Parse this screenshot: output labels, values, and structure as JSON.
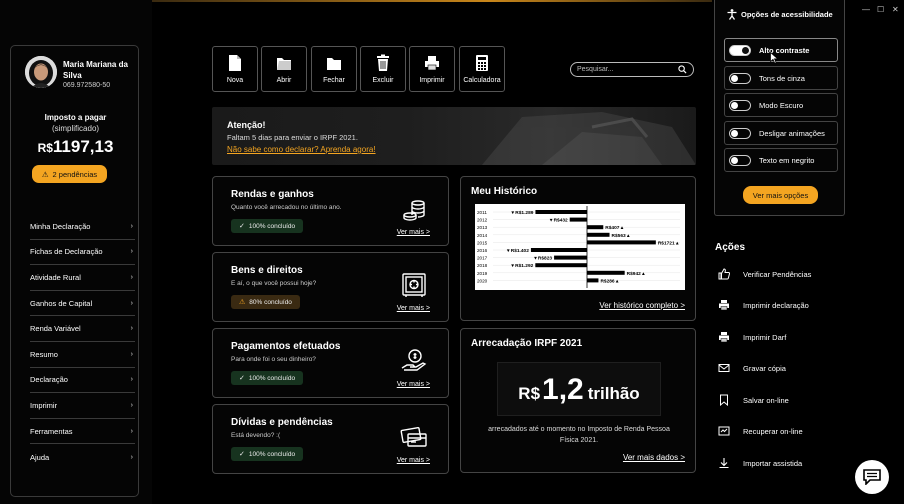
{
  "user": {
    "name": "Maria Mariana da Silva",
    "cpf": "069.972580-50"
  },
  "tax": {
    "label": "Imposto a pagar",
    "sub": "(simplificado)",
    "currency": "R$",
    "amount": "1197,13",
    "pending_label": "2 pendências"
  },
  "menu": [
    {
      "label": "Minha Declaração"
    },
    {
      "label": "Fichas de Declaração"
    },
    {
      "label": "Atividade Rural"
    },
    {
      "label": "Ganhos de Capital"
    },
    {
      "label": "Renda Variável"
    },
    {
      "label": "Resumo"
    },
    {
      "label": "Declaração"
    },
    {
      "label": "Imprimir"
    },
    {
      "label": "Ferramentas"
    },
    {
      "label": "Ajuda"
    }
  ],
  "toolbar": [
    {
      "label": "Nova",
      "icon": "file-icon"
    },
    {
      "label": "Abrir",
      "icon": "open-folder-icon"
    },
    {
      "label": "Fechar",
      "icon": "folder-icon"
    },
    {
      "label": "Excluir",
      "icon": "trash-icon"
    },
    {
      "label": "Imprimir",
      "icon": "printer-icon"
    },
    {
      "label": "Calculadora",
      "icon": "calculator-icon"
    }
  ],
  "search": {
    "placeholder": "Pesquisar..."
  },
  "alert": {
    "title": "Atenção!",
    "text": "Faltam 5 dias para enviar o IRPF 2021.",
    "link": "Não sabe como declarar? Aprenda agora!"
  },
  "cards": [
    {
      "title": "Rendas e ganhos",
      "sub": "Quanto você arrecadou no último ano.",
      "badge": "100% concluído",
      "status": "done",
      "link": "Ver mais >",
      "icon": "coins-icon"
    },
    {
      "title": "Bens e direitos",
      "sub": "E aí, o que você possui hoje?",
      "badge": "80% concluído",
      "status": "warn",
      "link": "Ver mais >",
      "icon": "safe-icon"
    },
    {
      "title": "Pagamentos efetuados",
      "sub": "Para onde foi o seu dinheiro?",
      "badge": "100% concluído",
      "status": "done",
      "link": "Ver mais >",
      "icon": "hand-coin-icon"
    },
    {
      "title": "Dívidas e pendências",
      "sub": "Está devendo? :(",
      "badge": "100% concluído",
      "status": "done",
      "link": "Ver mais >",
      "icon": "credit-cards-icon"
    }
  ],
  "historico": {
    "title": "Meu Histórico",
    "link": "Ver histórico completo >"
  },
  "chart_data": {
    "type": "bar",
    "orientation": "horizontal-diverging",
    "categories": [
      "2011",
      "2012",
      "2013",
      "2014",
      "2015",
      "2016",
      "2017",
      "2018",
      "2019",
      "2020"
    ],
    "values": [
      -1289,
      -432,
      407,
      563,
      1721,
      -1402,
      -823,
      -1292,
      942,
      286
    ],
    "labels": [
      "R$1.289",
      "R$432",
      "R$407",
      "R$563",
      "R$1721",
      "R$1.402",
      "R$823",
      "R$1.292",
      "R$942",
      "R$286"
    ]
  },
  "arrecadacao": {
    "title": "Arrecadação IRPF 2021",
    "currency": "R$",
    "number": "1,2",
    "unit": "trilhão",
    "desc": "arrecadados até o momento no Imposto de Renda Pessoa Física 2021.",
    "link": "Ver mais dados >"
  },
  "accessibility": {
    "title": "Opções de acessibilidade",
    "options": [
      {
        "label": "Alto contraste",
        "on": true
      },
      {
        "label": "Tons de cinza",
        "on": false
      },
      {
        "label": "Modo Escuro",
        "on": false
      },
      {
        "label": "Desligar animações",
        "on": false
      },
      {
        "label": "Texto em negrito",
        "on": false
      }
    ],
    "more": "Ver mais opções"
  },
  "actions": {
    "title": "Ações",
    "items": [
      {
        "label": "Verificar Pendências",
        "icon": "thumbs-up-icon"
      },
      {
        "label": "Imprimir declaração",
        "icon": "printer-icon"
      },
      {
        "label": "Imprimir Darf",
        "icon": "printer-icon"
      },
      {
        "label": "Gravar cópia",
        "icon": "envelope-icon"
      },
      {
        "label": "Salvar on-line",
        "icon": "bookmark-icon"
      },
      {
        "label": "Recuperar on-line",
        "icon": "recover-icon"
      },
      {
        "label": "Importar assistida",
        "icon": "download-icon"
      }
    ]
  }
}
